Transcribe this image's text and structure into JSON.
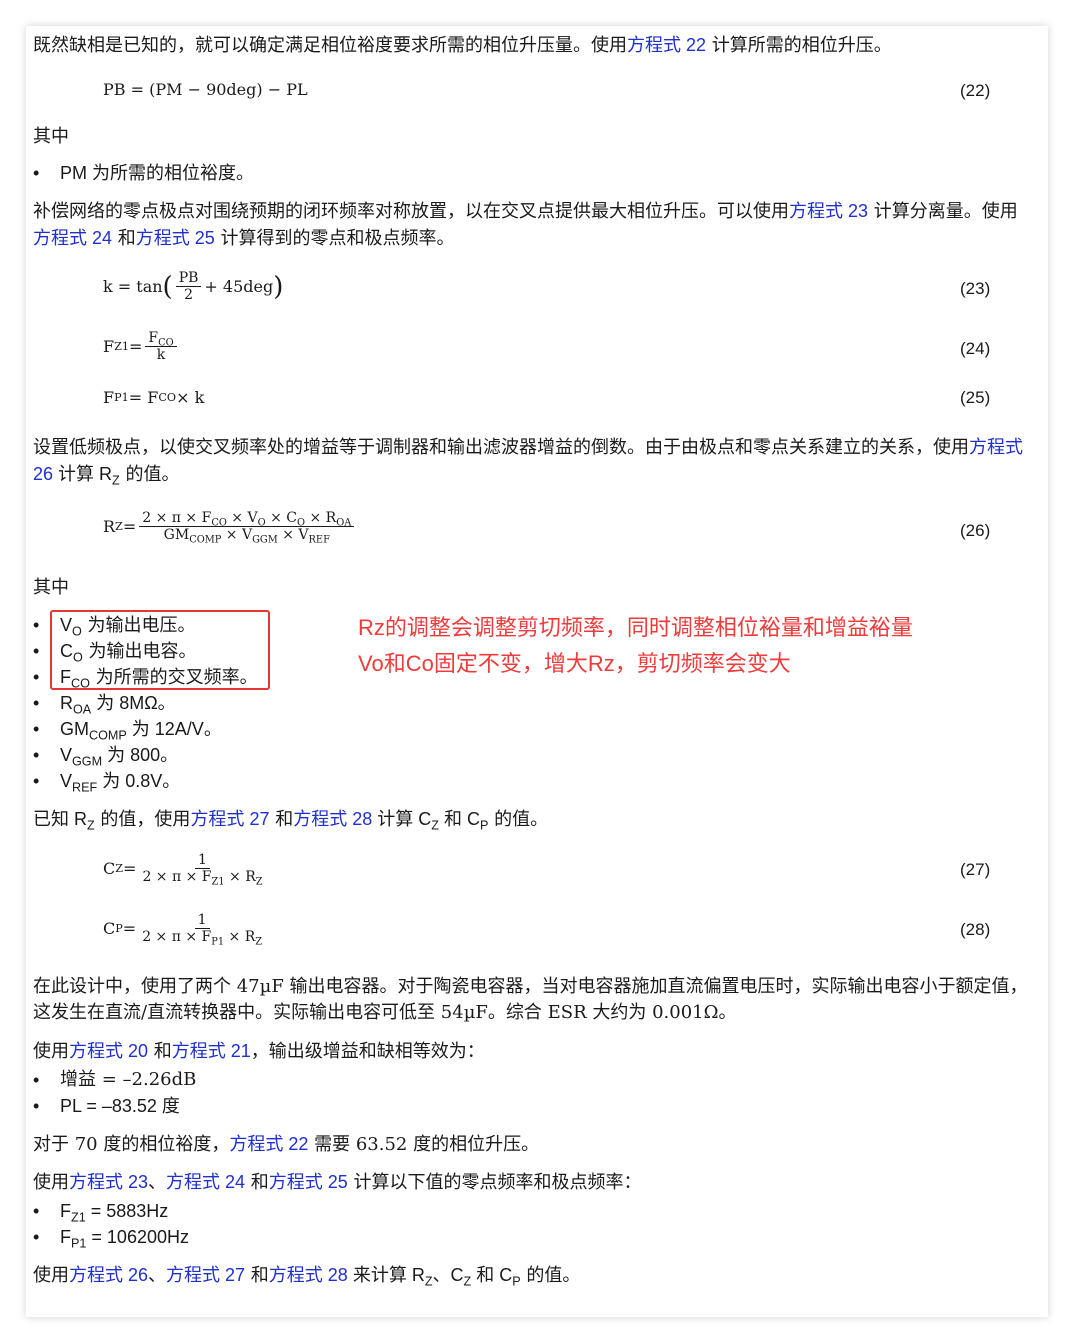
{
  "p1": {
    "a": "既然缺相是已知的，就可以确定满足相位裕度要求所需的相位升压量。使用",
    "link": "方程式 22",
    "b": " 计算所需的相位升压。"
  },
  "eq22": {
    "formula": "PB = (PM − 90deg) − PL",
    "num": "(22)"
  },
  "where1": "其中",
  "b1": "PM 为所需的相位裕度。",
  "p2": {
    "a": "补偿网络的零点极点对围绕预期的闭环频率对称放置，以在交叉点提供最大相位升压。可以使用",
    "l1": "方程式 23",
    "b": " 计算分离量。使用",
    "l2": "方程式 24",
    "c": " 和",
    "l3": "方程式 25",
    "d": " 计算得到的零点和极点频率。"
  },
  "eq23": {
    "left": "k = tan",
    "num_t": "PB",
    "den_t": "2",
    "right": "+ 45deg",
    "num": "(23)"
  },
  "eq24": {
    "left": "F",
    "sub": "Z1",
    "eq": " =",
    "num_t": "F",
    "num_sub": "CO",
    "den_t": "k",
    "num": "(24)"
  },
  "eq25": {
    "a": "F",
    "sub1": "P1",
    "b": " = F",
    "sub2": "CO",
    "c": " × k",
    "num": "(25)"
  },
  "p3": {
    "a": "设置低频极点，以使交叉频率处的增益等于调制器和输出滤波器增益的倒数。由于由极点和零点关系建立的关系，使用",
    "link": "方程式 26",
    "b": " 计算 R",
    "sub": "Z",
    "c": " 的值。"
  },
  "eq26": {
    "left": "R",
    "lsub": "Z",
    "eq": " =",
    "num_t": "2 × π × F",
    "ns1": "CO",
    "n2": " × V",
    "ns2": "O",
    "n3": " × C",
    "ns3": "O",
    "n4": " × R",
    "ns4": "OA",
    "d1": "GM",
    "ds1": "COMP",
    "d2": " × V",
    "ds2": "GGM",
    "d3": " × V",
    "ds3": "REF",
    "num": "(26)"
  },
  "where2": "其中",
  "bullets2": [
    {
      "m": "V",
      "sub": "O",
      "t": " 为输出电压。"
    },
    {
      "m": "C",
      "sub": "O",
      "t": " 为输出电容。"
    },
    {
      "m": "F",
      "sub": "CO",
      "t": " 为所需的交叉频率。"
    },
    {
      "m": "R",
      "sub": "OA",
      "t": " 为 8MΩ。"
    },
    {
      "m": "GM",
      "sub": "COMP",
      "t": " 为 12A/V。"
    },
    {
      "m": "V",
      "sub": "GGM",
      "t": " 为 800。"
    },
    {
      "m": "V",
      "sub": "REF",
      "t": " 为 0.8V。"
    }
  ],
  "annotation": {
    "line1": "Rz的调整会调整剪切频率，同时调整相位裕量和增益裕量",
    "line2": "Vo和Co固定不变，增大Rz，剪切频率会变大",
    "color": "#ef3b3b"
  },
  "p4": {
    "a": "已知 R",
    "sub": "Z",
    "b": " 的值，使用",
    "l1": "方程式 27",
    "c": " 和",
    "l2": "方程式 28",
    "d": " 计算 C",
    "sub2": "Z",
    "e": " 和 C",
    "sub3": "P",
    "f": " 的值。"
  },
  "eq27": {
    "left": "C",
    "lsub": "Z",
    "eq": " =",
    "num_t": "1",
    "d1": "2 × π × F",
    "ds1": "Z1",
    "d2": " × R",
    "ds2": "Z",
    "num": "(27)"
  },
  "eq28": {
    "left": "C",
    "lsub": "P",
    "eq": " =",
    "num_t": "1",
    "d1": "2 × π × F",
    "ds1": "P1",
    "d2": " × R",
    "ds2": "Z",
    "num": "(28)"
  },
  "p5": "在此设计中，使用了两个 47µF 输出电容器。对于陶瓷电容器，当对电容器施加直流偏置电压时，实际输出电容小于额定值，这发生在直流/直流转换器中。实际输出电容可低至 54µF。综合 ESR 大约为 0.001Ω。",
  "p6": {
    "a": "使用",
    "l1": "方程式 20",
    "b": " 和",
    "l2": "方程式 21",
    "c": "，输出级增益和缺相等效为："
  },
  "bullets3": [
    "增益 = –2.26dB",
    "PL = –83.52 度"
  ],
  "p7": {
    "a": "对于 70 度的相位裕度，",
    "link": "方程式 22",
    "b": " 需要 63.52 度的相位升压。"
  },
  "p8": {
    "a": "使用",
    "l1": "方程式 23",
    "s1": "、",
    "l2": "方程式 24",
    "b": " 和",
    "l3": "方程式 25",
    "c": " 计算以下值的零点频率和极点频率："
  },
  "bullets4": [
    {
      "m": "F",
      "sub": "Z1",
      "t": " = 5883Hz"
    },
    {
      "m": "F",
      "sub": "P1",
      "t": " = 106200Hz"
    }
  ],
  "p9": {
    "a": "使用",
    "l1": "方程式 26",
    "s1": "、",
    "l2": "方程式 27",
    "b": " 和",
    "l3": "方程式 28",
    "c": " 来计算 R",
    "sub1": "Z",
    "s2": "、C",
    "sub2": "Z",
    "d": " 和 C",
    "sub3": "P",
    "e": " 的值。"
  },
  "bullet_glyph": "•"
}
